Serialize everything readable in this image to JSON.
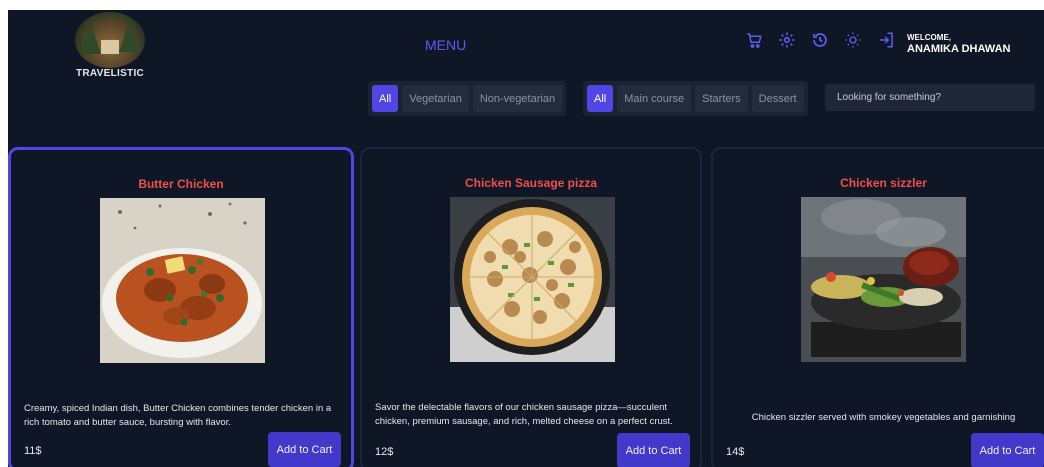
{
  "brand": {
    "name": "TRAVELISTIC"
  },
  "header": {
    "title": "MENU",
    "icons": [
      "cart-icon",
      "gear-icon",
      "history-icon",
      "sun-icon",
      "logout-icon"
    ],
    "welcome_label": "WELCOME,",
    "user_name": "ANAMIKA DHAWAN"
  },
  "filters": {
    "diet": [
      {
        "label": "All",
        "active": true
      },
      {
        "label": "Vegetarian",
        "active": false
      },
      {
        "label": "Non-vegetarian",
        "active": false
      }
    ],
    "course": [
      {
        "label": "All",
        "active": true
      },
      {
        "label": "Main course",
        "active": false
      },
      {
        "label": "Starters",
        "active": false
      },
      {
        "label": "Dessert",
        "active": false
      }
    ],
    "search_placeholder": "Looking for something?"
  },
  "items": [
    {
      "name": "Butter Chicken",
      "description": "Creamy, spiced Indian dish, Butter Chicken combines tender chicken in a rich tomato and butter sauce, bursting with flavor.",
      "price": "11$",
      "button": "Add to Cart"
    },
    {
      "name": "Chicken Sausage pizza",
      "description": "Savor the delectable flavors of our chicken sausage pizza—succulent chicken, premium sausage, and rich, melted cheese on a perfect crust.",
      "price": "12$",
      "button": "Add to Cart"
    },
    {
      "name": "Chicken sizzler",
      "description": "Chicken sizzler served with smokey vegetables and garnishing",
      "price": "14$",
      "button": "Add to Cart"
    }
  ],
  "colors": {
    "background": "#0f1626",
    "accent": "#4f46e5",
    "title_red": "#f0504a"
  }
}
